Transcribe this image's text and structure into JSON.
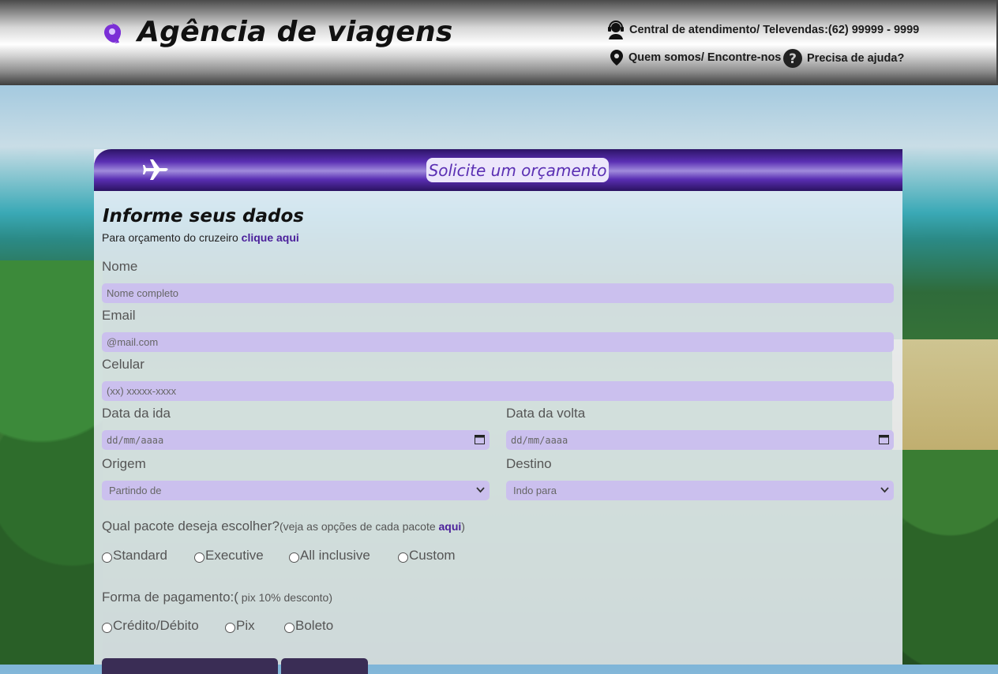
{
  "header": {
    "brand": "Agência de viagens",
    "central": "Central de atendimento/ Televendas:(62) 99999 - 9999",
    "quem_somos": "Quem somos/ Encontre-nos",
    "ajuda": "Precisa de ajuda?"
  },
  "form": {
    "bar_title": "Solicite um orçamento",
    "title": "Informe seus dados",
    "subtitle": "Para orçamento do cruzeiro",
    "subtitle_link": "clique aqui",
    "nome_label": "Nome",
    "nome_placeholder": "Nome completo",
    "email_label": "Email",
    "email_placeholder": "@mail.com",
    "celular_label": "Celular",
    "celular_placeholder": "(xx) xxxxx-xxxx",
    "ida_label": "Data da ida",
    "ida_value": "dd/mm/aaaa",
    "volta_label": "Data da volta",
    "volta_value": "dd/mm/aaaa",
    "origem_label": "Origem",
    "origem_value": "Partindo de",
    "destino_label": "Destino",
    "destino_value": "Indo para",
    "pacote_question": "Qual pacote deseja escolher?",
    "pacote_note_pre": "(veja as opções de cada pacote ",
    "pacote_note_link": "aqui",
    "pacote_note_post": ")",
    "pacotes": [
      "Standard",
      "Executive",
      "All inclusive",
      "Custom"
    ],
    "pagamento_question": "Forma de pagamento:(",
    "pagamento_note": " pix 10% desconto)",
    "pagamentos": [
      "Crédito/Débito",
      "Pix",
      "Boleto"
    ]
  },
  "colors": {
    "accent": "#5a2fb3",
    "field_bg": "#cbc0ee",
    "link": "#4a1f9a"
  },
  "icons": [
    "map-pin-icon",
    "headset-icon",
    "location-icon",
    "help-icon",
    "airplane-icon",
    "calendar-icon",
    "chevron-down-icon"
  ]
}
